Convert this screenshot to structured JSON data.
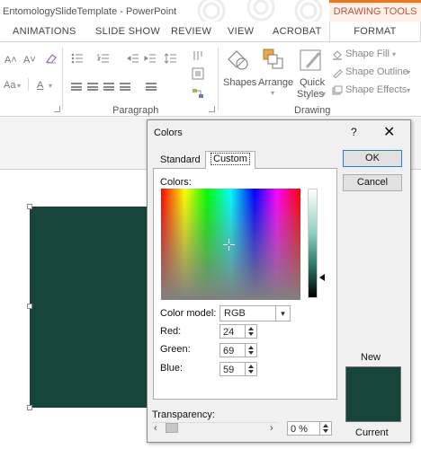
{
  "window": {
    "title": "EntomologySlideTemplate - PowerPoint",
    "contextual_tab_group": "DRAWING TOOLS"
  },
  "ribbon_tabs": [
    "ANIMATIONS",
    "SLIDE SHOW",
    "REVIEW",
    "VIEW",
    "ACROBAT",
    "FORMAT"
  ],
  "ribbon": {
    "font_size_up": "A˄",
    "font_size_down": "A˅",
    "change_case": "Aa",
    "font_color": "A",
    "paragraph_group": "Paragraph",
    "drawing_group": "Drawing",
    "shapes": "Shapes",
    "arrange": "Arrange",
    "quick_styles_line1": "Quick",
    "quick_styles_line2": "Styles",
    "shape_fill": "Shape Fill",
    "shape_outline": "Shape Outline",
    "shape_effects": "Shape Effects"
  },
  "dialog": {
    "title": "Colors",
    "help": "?",
    "close": "✕",
    "tabs": [
      "Standard",
      "Custom"
    ],
    "active_tab": "Custom",
    "ok_label": "OK",
    "cancel_label": "Cancel",
    "colors_label": "Colors:",
    "color_model_label": "Color model:",
    "color_model_value": "RGB",
    "red_label": "Red:",
    "red_value": "24",
    "green_label": "Green:",
    "green_value": "69",
    "blue_label": "Blue:",
    "blue_value": "59",
    "new_label": "New",
    "current_label": "Current",
    "transparency_label": "Transparency:",
    "transparency_value": "0 %",
    "transparency_level": 0,
    "selected_color": "#18453b"
  },
  "colors": {
    "accent_orange": "#e87722",
    "contextual_text": "#c0504d",
    "slide_shape_fill": "#18453b"
  }
}
